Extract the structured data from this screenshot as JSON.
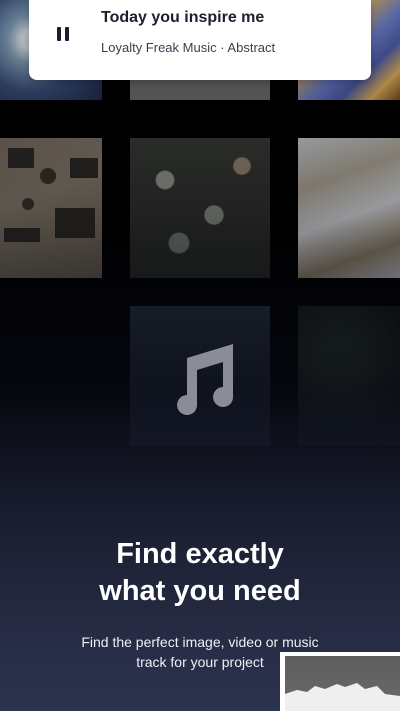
{
  "now_playing": {
    "title": "Today you inspire me",
    "subtitle": "Loyalty Freak Music · Abstract",
    "control_icon": "pause-icon"
  },
  "hero": {
    "headline_line1": "Find exactly",
    "headline_line2": "what you need",
    "description_line1": "Find the perfect image, video or music",
    "description_line2": "track for your project"
  },
  "colors": {
    "card_bg": "#ffffff",
    "title_color": "#1b1f2e",
    "bottom_gradient": "#2d3450"
  },
  "icons": [
    "pause-icon",
    "music-note-icon"
  ]
}
